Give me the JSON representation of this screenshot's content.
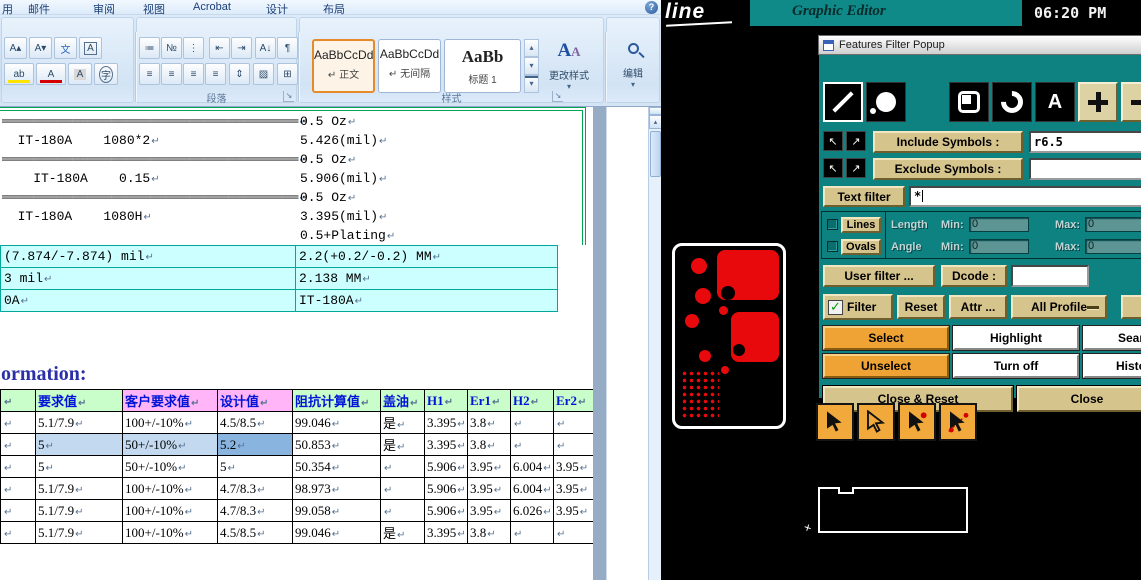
{
  "palette": {
    "teal": "#0e8181",
    "khaki": "#d6c48d",
    "orange": "#f0a335",
    "signal_red": "#e8090c",
    "header_green": "#c9fdc9",
    "header_pink": "#ffb5f7",
    "cyan_cell": "#ccffff",
    "green_border": "#00a550",
    "selection_blue": "#8ab4e0",
    "ribbon_blue": "#d9e9f8"
  },
  "icons": {
    "help": "?",
    "grow_font": "A▴",
    "shrink_font": "A▾",
    "ruby_guide": "文",
    "char_border": "A",
    "highlight_pen": "ab",
    "font_color": "A",
    "char_shading": "A",
    "enclose_char": "字",
    "bullets": "≔",
    "numbering": "№",
    "multilevel": "⋮",
    "dec_indent": "⇤",
    "inc_indent": "⇥",
    "sort": "A↓",
    "pilcrow": "¶",
    "align_left": "≡",
    "align_center": "≡",
    "align_right": "≡",
    "justify": "≡",
    "line_spacing": "⇕",
    "shading": "▨",
    "borders": "⊞",
    "dropdown": "▾",
    "scroll_up": "▴",
    "scroll_down": "▾",
    "launcher": "↘",
    "nw_arrow": "↖",
    "ne_arrow": "↗",
    "check": "✓",
    "change_styles_icon": "A",
    "return_mark": "↵"
  },
  "word": {
    "menu": {
      "partial_tab": "用",
      "tabs": [
        "邮件",
        "审阅",
        "视图",
        "Acrobat",
        "设计",
        "布局"
      ]
    },
    "ribbon": {
      "paragraph_label": "段落",
      "styles_label": "样式",
      "styles": [
        {
          "preview": "AaBbCcDd",
          "label": "↵ 正文"
        },
        {
          "preview": "AaBbCcDd",
          "label": "↵ 无间隔"
        },
        {
          "preview": "AaBb",
          "label": "标题 1"
        }
      ],
      "change_styles_label": "更改样式",
      "editing_label": "编辑"
    },
    "doc": {
      "separator": "══════════════════════════════════════",
      "spec_rows": [
        {
          "sep": true,
          "left": "",
          "right": "0.5 Oz"
        },
        {
          "sep": false,
          "left": "  IT-180A    1080*2",
          "right": "5.426(mil)"
        },
        {
          "sep": true,
          "left": "",
          "right": "0.5 Oz"
        },
        {
          "sep": false,
          "left": "    IT-180A    0.15",
          "right": "5.906(mil)"
        },
        {
          "sep": true,
          "left": "",
          "right": "0.5 Oz"
        },
        {
          "sep": false,
          "left": "  IT-180A    1080H",
          "right": "3.395(mil)"
        },
        {
          "sep": false,
          "left": "",
          "right": "0.5+Plating"
        }
      ],
      "tolerance_rows": [
        {
          "left": "(7.874/-7.874) mil",
          "right": "2.2(+0.2/-0.2) MM"
        },
        {
          "left": "3 mil",
          "right": "2.138 MM"
        },
        {
          "left": "0A",
          "right": "IT-180A"
        }
      ],
      "heading": "ormation:",
      "table": {
        "headers": [
          "",
          "要求值",
          "客户要求值",
          "设计值",
          "阻抗计算值",
          "盖油",
          "H1",
          "Er1",
          "H2",
          "Er2"
        ],
        "pink_header_cols": [
          2,
          3
        ],
        "rows": [
          [
            "",
            "5.1/7.9",
            "100+/-10%",
            "4.5/8.5",
            "99.046",
            "是",
            "3.395",
            "3.8",
            "",
            ""
          ],
          [
            "",
            "5",
            "50+/-10%",
            "5.2",
            "50.853",
            "是",
            "3.395",
            "3.8",
            "",
            ""
          ],
          [
            "",
            "5",
            "50+/-10%",
            "5",
            "50.354",
            "",
            "5.906",
            "3.95",
            "6.004",
            "3.95"
          ],
          [
            "",
            "5.1/7.9",
            "100+/-10%",
            "4.7/8.3",
            "98.973",
            "",
            "5.906",
            "3.95",
            "6.004",
            "3.95"
          ],
          [
            "",
            "5.1/7.9",
            "100+/-10%",
            "4.7/8.3",
            "99.058",
            "",
            "5.906",
            "3.95",
            "6.026",
            "3.95"
          ],
          [
            "",
            "5.1/7.9",
            "100+/-10%",
            "4.5/8.5",
            "99.046",
            "是",
            "3.395",
            "3.8",
            "",
            ""
          ]
        ],
        "selection": {
          "row": 1,
          "light_cols": [
            1,
            2
          ],
          "strong_col": 3
        }
      }
    }
  },
  "cam": {
    "logo": "line",
    "app_title": "Graphic Editor",
    "clock": "06:20 PM",
    "dialog": {
      "title": "Features Filter Popup",
      "include_label": "Include Symbols :",
      "include_value": "r6.5",
      "exclude_label": "Exclude Symbols :",
      "exclude_value": "",
      "text_filter_label": "Text filter",
      "text_filter_value": "*",
      "lines_label": "Lines",
      "ovals_label": "Ovals",
      "length_label": "Length",
      "angle_label": "Angle",
      "min_label": "Min:",
      "max_label": "Max:",
      "length_min": "0",
      "length_max": "0",
      "angle_min": "0",
      "angle_max": "0",
      "user_filter_label": "User filter ...",
      "dcode_label": "Dcode :",
      "dcode_value": "",
      "filter_label": "Filter",
      "reset_label": "Reset",
      "attr_label": "Attr ...",
      "all_profile_label": "All Profile",
      "select_label": "Select",
      "highlight_label": "Highlight",
      "search_label_partial": "Sear",
      "unselect_label": "Unselect",
      "turn_off_label": "Turn off",
      "histogram_label_partial": "Histo",
      "close_reset_label": "Close & Reset",
      "close_label": "Close"
    }
  }
}
